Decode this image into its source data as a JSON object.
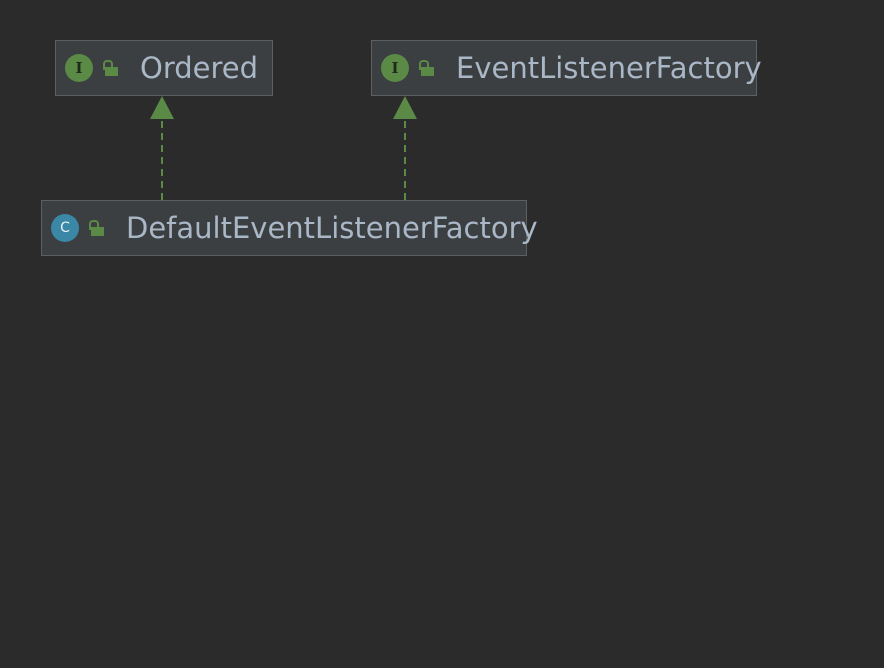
{
  "diagram": {
    "nodes": [
      {
        "id": "ordered",
        "kind": "interface",
        "badge": "I",
        "label": "Ordered"
      },
      {
        "id": "elf",
        "kind": "interface",
        "badge": "I",
        "label": "EventListenerFactory"
      },
      {
        "id": "delf",
        "kind": "class",
        "badge": "C",
        "label": "DefaultEventListenerFactory"
      }
    ],
    "edges": [
      {
        "from": "DefaultEventListenerFactory",
        "to": "Ordered",
        "type": "implements"
      },
      {
        "from": "DefaultEventListenerFactory",
        "to": "EventListenerFactory",
        "type": "implements"
      }
    ],
    "colors": {
      "background": "#2b2b2b",
      "node_fill": "#3c3f41",
      "node_border": "#5e6060",
      "text": "#a9b7c6",
      "interface_badge": "#5a8a45",
      "class_badge": "#3a87a6",
      "edge": "#5a8a45"
    },
    "icons": {
      "interface_badge": "interface-icon",
      "class_badge": "class-icon",
      "visibility": "public-lock-icon"
    }
  }
}
